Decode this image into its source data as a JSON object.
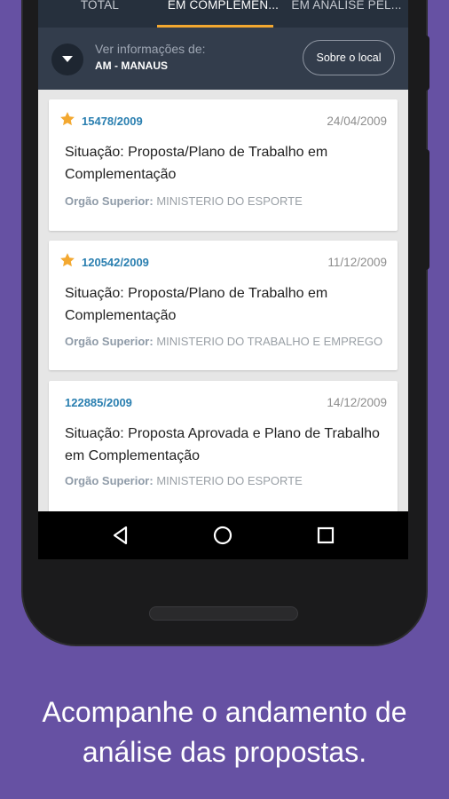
{
  "tabs": [
    {
      "label": "TOTAL"
    },
    {
      "label": "EM COMPLEMEN..."
    },
    {
      "label": "EM ANÁLISE PEL..."
    }
  ],
  "location": {
    "label": "Ver informações de:",
    "value": "AM - MANAUS",
    "about_button": "Sobre o local"
  },
  "proposals": [
    {
      "number": "15478/2009",
      "date": "24/04/2009",
      "starred": true,
      "status": "Situação: Proposta/Plano de Trabalho em Complementação",
      "org_label": "Orgão Superior:",
      "org_value": "MINISTERIO DO ESPORTE"
    },
    {
      "number": "120542/2009",
      "date": "11/12/2009",
      "starred": true,
      "status": "Situação: Proposta/Plano de Trabalho em Complementação",
      "org_label": "Orgão Superior:",
      "org_value": "MINISTERIO DO TRABALHO E EMPREGO"
    },
    {
      "number": "122885/2009",
      "date": "14/12/2009",
      "starred": false,
      "status": "Situação: Proposta Aprovada e Plano de Trabalho em Complementação",
      "org_label": "Orgão Superior:",
      "org_value": "MINISTERIO DO ESPORTE"
    }
  ],
  "navbar": {
    "icons": [
      "back-icon",
      "home-icon",
      "recents-icon"
    ]
  },
  "caption": "Acompanhe o andamento de análise das propostas.",
  "colors": {
    "background": "#6651a3",
    "tab_indicator": "#f3a830",
    "star": "#f3a830",
    "proposal_number": "#2a7fb0"
  }
}
